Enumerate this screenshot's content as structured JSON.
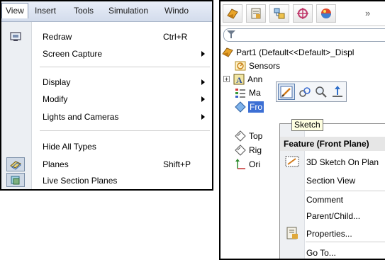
{
  "left_menu": {
    "menubar": [
      "View",
      "Insert",
      "Tools",
      "Simulation",
      "Windo"
    ],
    "items": [
      {
        "label": "Redraw",
        "shortcut": "Ctrl+R"
      },
      {
        "label": "Screen Capture"
      },
      {
        "label": "Display"
      },
      {
        "label": "Modify"
      },
      {
        "label": "Lights and Cameras"
      },
      {
        "label": "Hide All Types"
      },
      {
        "label": "Planes",
        "shortcut": "Shift+P"
      },
      {
        "label": "Live Section Planes"
      }
    ]
  },
  "feature_manager": {
    "toolbar_overflow": "»",
    "tree": {
      "part": "Part1  (Default<<Default>_Displ",
      "sensors": "Sensors",
      "annotations": "Ann",
      "material": "Ma",
      "front_plane": "Fro",
      "top_plane": "Top",
      "right_plane": "Rig",
      "origin": "Ori"
    },
    "tooltip": "Sketch",
    "context_menu": {
      "header": "Feature (Front Plane)",
      "items": [
        "3D Sketch On Plan",
        "Section View",
        "Comment",
        "Parent/Child...",
        "Properties...",
        "Go To..."
      ]
    }
  },
  "colors": {
    "menu_highlight": "#cfd9e6",
    "tooltip_bg": "#ffffe1",
    "selection": "#3c6fd4"
  }
}
